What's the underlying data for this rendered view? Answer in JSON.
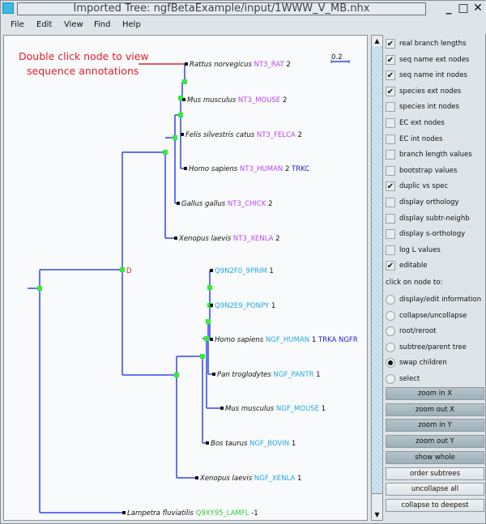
{
  "window": {
    "title": "Imported Tree: ngfBetaExample/input/1WWW_V_MB.nhx",
    "controls": [
      "_",
      "□",
      "✕"
    ]
  },
  "menu": [
    "File",
    "Edit",
    "View",
    "Find",
    "Help"
  ],
  "annotation": {
    "line1": "Double click node to view",
    "line2": "sequence annotations",
    "color": "#e8202a"
  },
  "scale_bar": {
    "label": "0.2"
  },
  "colors": {
    "branch": "#3344ee",
    "node_internal": "#33ee33",
    "node_external": "#111111",
    "nt3_seq": "#bb44ee",
    "ngf_seq": "#22aadd",
    "outgroup_seq": "#33cc33",
    "ec_annotation": "#2222cc",
    "duplication": "#e8202a"
  },
  "tree": {
    "duplication_label": "D",
    "leaves": [
      {
        "species": "Rattus norvegicus",
        "seq": "NT3_RAT",
        "group": "nt3",
        "value": "2",
        "annot": ""
      },
      {
        "species": "Mus musculus",
        "seq": "NT3_MOUSE",
        "group": "nt3",
        "value": "2",
        "annot": ""
      },
      {
        "species": "Felis silvestris catus",
        "seq": "NT3_FELCA",
        "group": "nt3",
        "value": "2",
        "annot": ""
      },
      {
        "species": "Homo sapiens",
        "seq": "NT3_HUMAN",
        "group": "nt3",
        "value": "2",
        "annot": "TRKC"
      },
      {
        "species": "Gallus gallus",
        "seq": "NT3_CHICK",
        "group": "nt3",
        "value": "2",
        "annot": ""
      },
      {
        "species": "Xenopus laevis",
        "seq": "NT3_XENLA",
        "group": "nt3",
        "value": "2",
        "annot": ""
      },
      {
        "species": "",
        "seq": "Q9N2F0_9PRIM",
        "group": "ngf",
        "value": "1",
        "annot": ""
      },
      {
        "species": "",
        "seq": "Q9N2E9_PONPY",
        "group": "ngf",
        "value": "1",
        "annot": ""
      },
      {
        "species": "Homo sapiens",
        "seq": "NGF_HUMAN",
        "group": "ngf",
        "value": "1",
        "annot": "TRKA NGFR"
      },
      {
        "species": "Pan troglodytes",
        "seq": "NGF_PANTR",
        "group": "ngf",
        "value": "1",
        "annot": ""
      },
      {
        "species": "Mus musculus",
        "seq": "NGF_MOUSE",
        "group": "ngf",
        "value": "1",
        "annot": ""
      },
      {
        "species": "Bos taurus",
        "seq": "NGF_BOVIN",
        "group": "ngf",
        "value": "1",
        "annot": ""
      },
      {
        "species": "Xenopus laevis",
        "seq": "NGF_XENLA",
        "group": "ngf",
        "value": "1",
        "annot": ""
      },
      {
        "species": "Lampetra fluviatilis",
        "seq": "Q9XY95_LAMFL",
        "group": "outgroup",
        "value": "-1",
        "annot": ""
      }
    ]
  },
  "options": {
    "checkboxes": [
      {
        "label": "real branch lengths",
        "checked": true
      },
      {
        "label": "seq name ext nodes",
        "checked": true
      },
      {
        "label": "seq name int nodes",
        "checked": true
      },
      {
        "label": "species ext nodes",
        "checked": true
      },
      {
        "label": "species int nodes",
        "checked": false
      },
      {
        "label": "EC ext nodes",
        "checked": false
      },
      {
        "label": "EC int nodes",
        "checked": false
      },
      {
        "label": "branch length values",
        "checked": false
      },
      {
        "label": "bootstrap values",
        "checked": false
      },
      {
        "label": "duplic vs spec",
        "checked": true
      },
      {
        "label": "display orthology",
        "checked": false
      },
      {
        "label": "display subtr-neighb",
        "checked": false
      },
      {
        "label": "display s-orthology",
        "checked": false
      },
      {
        "label": "log L values",
        "checked": false
      },
      {
        "label": "editable",
        "checked": true
      }
    ],
    "click_label": "click on node to:",
    "radios": [
      {
        "label": "display/edit information",
        "selected": false
      },
      {
        "label": "collapse/uncollapse",
        "selected": false
      },
      {
        "label": "root/reroot",
        "selected": false
      },
      {
        "label": "subtree/parent tree",
        "selected": false
      },
      {
        "label": "swap children",
        "selected": true
      },
      {
        "label": "select",
        "selected": false
      }
    ],
    "buttons": [
      {
        "label": "zoom in X",
        "style": "dark"
      },
      {
        "label": "zoom out X",
        "style": "dark"
      },
      {
        "label": "zoom in Y",
        "style": "dark"
      },
      {
        "label": "zoom out Y",
        "style": "dark"
      },
      {
        "label": "show whole",
        "style": "dark"
      },
      {
        "label": "order subtrees",
        "style": "light"
      },
      {
        "label": "uncollapse all",
        "style": "light"
      },
      {
        "label": "collapse to deepest",
        "style": "light"
      }
    ]
  }
}
